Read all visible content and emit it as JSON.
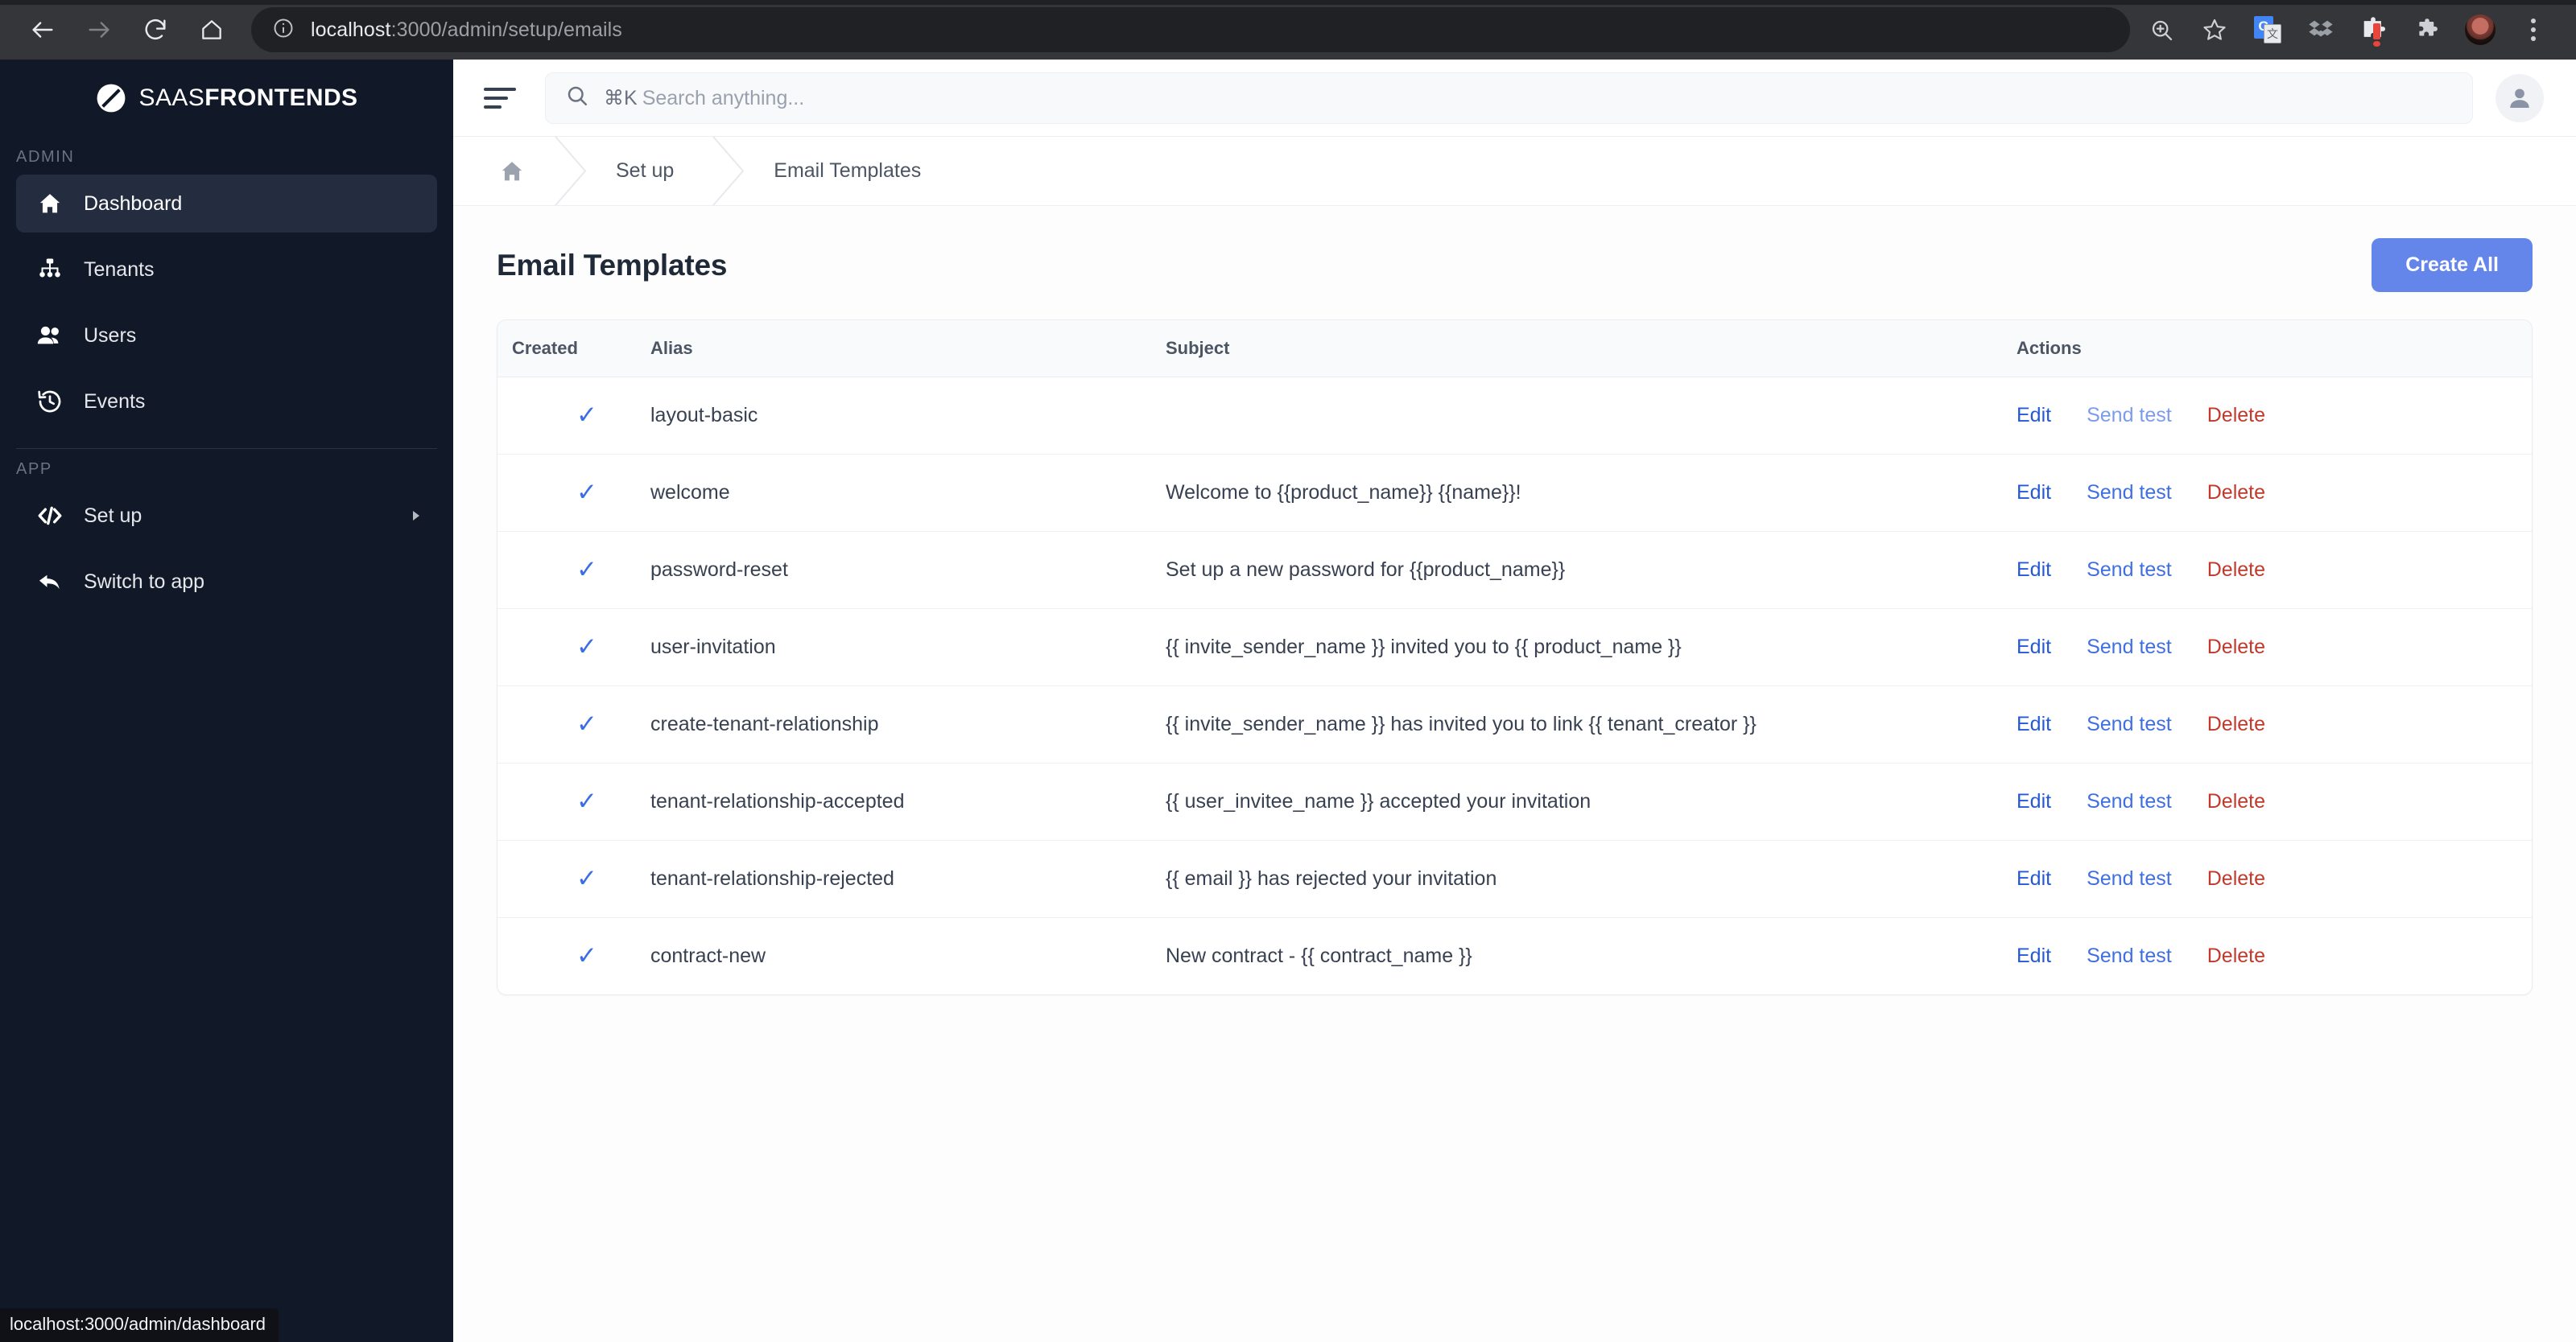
{
  "browser": {
    "url_bold": "localhost",
    "url_rest": ":3000/admin/setup/emails",
    "back_icon": "back-arrow-icon",
    "forward_icon": "forward-arrow-icon",
    "reload_icon": "reload-icon",
    "home_icon": "home-icon",
    "info_icon": "site-info-icon",
    "zoom_icon": "zoom-in-icon",
    "bookmark_icon": "star-icon",
    "translate_icon": "google-translate-icon",
    "translate_letter": "G",
    "translate_letter2": "文",
    "dropbox_icon": "dropbox-icon",
    "puzzle_icon": "extensions-puzzle-icon",
    "profile_icon": "browser-profile-avatar",
    "menu_icon": "browser-kebab-menu-icon"
  },
  "status_bar": {
    "text": "localhost:3000/admin/dashboard"
  },
  "sidebar": {
    "brand": {
      "name_light": "SAAS",
      "name_bold": "FRONTENDS",
      "logo_icon": "saasfrontends-logo-icon"
    },
    "sections": [
      {
        "label": "ADMIN",
        "items": [
          {
            "label": "Dashboard",
            "icon": "home-icon",
            "active": true
          },
          {
            "label": "Tenants",
            "icon": "sitemap-icon",
            "active": false
          },
          {
            "label": "Users",
            "icon": "users-icon",
            "active": false
          },
          {
            "label": "Events",
            "icon": "history-clock-icon",
            "active": false
          }
        ]
      },
      {
        "label": "APP",
        "items": [
          {
            "label": "Set up",
            "icon": "code-brackets-icon",
            "active": false,
            "caret": true
          },
          {
            "label": "Switch to app",
            "icon": "reply-arrow-icon",
            "active": false
          }
        ]
      }
    ]
  },
  "topbar": {
    "menu_toggle_icon": "hamburger-menu-icon",
    "search": {
      "icon": "search-icon",
      "shortcut": "⌘K",
      "placeholder": "Search anything...",
      "value": ""
    },
    "avatar_icon": "user-avatar-icon"
  },
  "breadcrumb": {
    "home_icon": "home-icon",
    "items": [
      {
        "label": "Set up"
      },
      {
        "label": "Email Templates"
      }
    ]
  },
  "page": {
    "title": "Email Templates",
    "create_all_label": "Create All"
  },
  "table": {
    "columns": [
      "Created",
      "Alias",
      "Subject",
      "Actions"
    ],
    "actions": {
      "edit": "Edit",
      "send_test": "Send test",
      "delete": "Delete"
    },
    "created_check": "✓",
    "rows": [
      {
        "created": true,
        "alias": "layout-basic",
        "subject": "",
        "send_muted": true
      },
      {
        "created": true,
        "alias": "welcome",
        "subject": "Welcome to {{product_name}} {{name}}!",
        "send_muted": false
      },
      {
        "created": true,
        "alias": "password-reset",
        "subject": "Set up a new password for {{product_name}}",
        "send_muted": false
      },
      {
        "created": true,
        "alias": "user-invitation",
        "subject": "{{ invite_sender_name }} invited you to {{ product_name }}",
        "send_muted": false
      },
      {
        "created": true,
        "alias": "create-tenant-relationship",
        "subject": "{{ invite_sender_name }} has invited you to link {{ tenant_creator }}",
        "send_muted": false
      },
      {
        "created": true,
        "alias": "tenant-relationship-accepted",
        "subject": "{{ user_invitee_name }} accepted your invitation",
        "send_muted": false
      },
      {
        "created": true,
        "alias": "tenant-relationship-rejected",
        "subject": "{{ email }} has rejected your invitation",
        "send_muted": false
      },
      {
        "created": true,
        "alias": "contract-new",
        "subject": "New contract - {{ contract_name }}",
        "send_muted": false
      }
    ]
  },
  "colors": {
    "sidebar_bg": "#111827",
    "sidebar_active": "#242c40",
    "primary": "#6485ea",
    "link": "#2659d6",
    "danger": "#c0392b",
    "check": "#3b6fe0"
  }
}
